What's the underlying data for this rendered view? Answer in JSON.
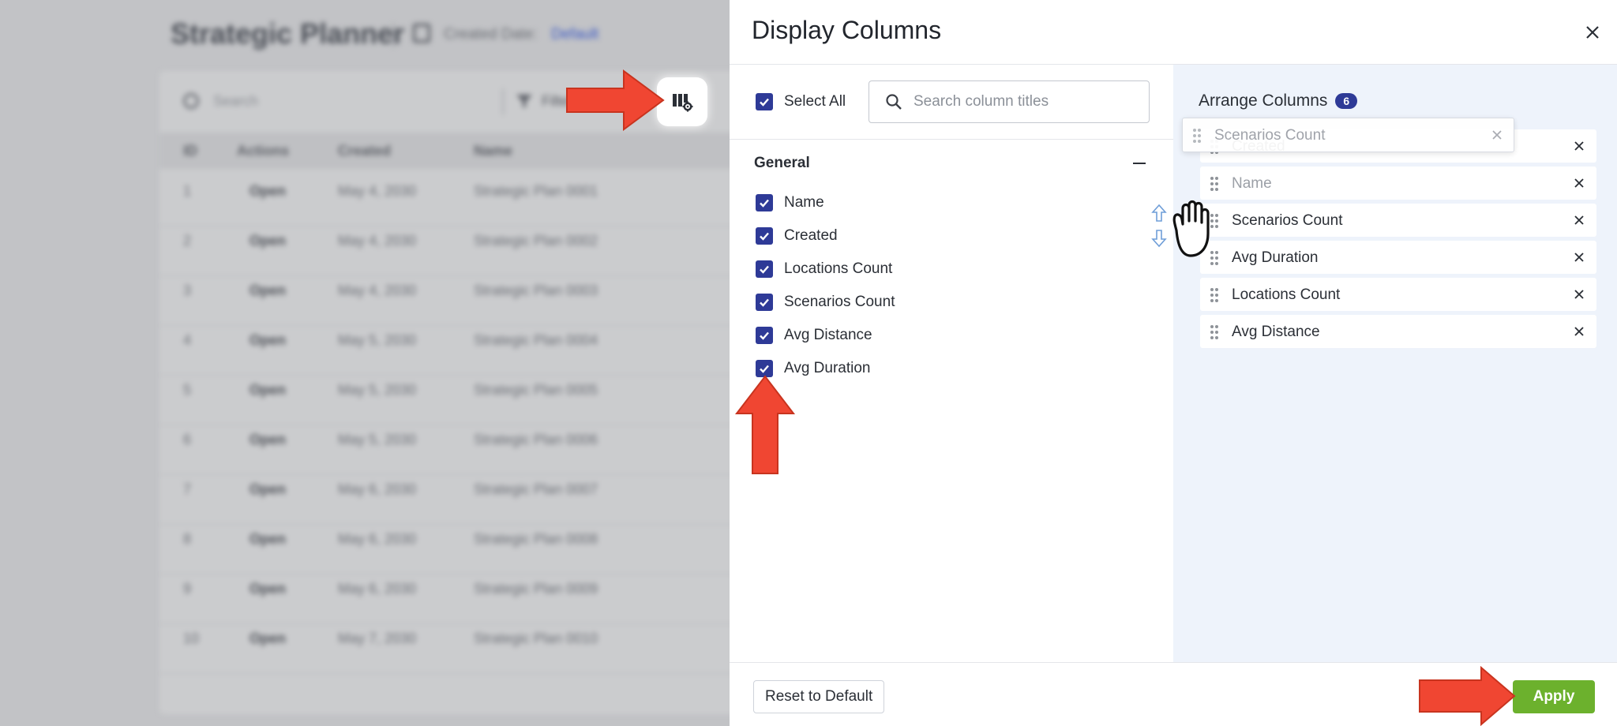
{
  "background": {
    "title": "Strategic Planner",
    "date_label": "Created Date:",
    "date_value": "Default",
    "search_placeholder": "Search",
    "filter_label": "Filter",
    "headers": [
      "ID",
      "Actions",
      "Created",
      "Name"
    ],
    "rows": [
      {
        "id": "1",
        "action": "Open",
        "created": "May 4, 2030",
        "name": "Strategic Plan 0001"
      },
      {
        "id": "2",
        "action": "Open",
        "created": "May 4, 2030",
        "name": "Strategic Plan 0002"
      },
      {
        "id": "3",
        "action": "Open",
        "created": "May 4, 2030",
        "name": "Strategic Plan 0003"
      },
      {
        "id": "4",
        "action": "Open",
        "created": "May 5, 2030",
        "name": "Strategic Plan 0004"
      },
      {
        "id": "5",
        "action": "Open",
        "created": "May 5, 2030",
        "name": "Strategic Plan 0005"
      },
      {
        "id": "6",
        "action": "Open",
        "created": "May 5, 2030",
        "name": "Strategic Plan 0006"
      },
      {
        "id": "7",
        "action": "Open",
        "created": "May 6, 2030",
        "name": "Strategic Plan 0007"
      },
      {
        "id": "8",
        "action": "Open",
        "created": "May 6, 2030",
        "name": "Strategic Plan 0008"
      },
      {
        "id": "9",
        "action": "Open",
        "created": "May 6, 2030",
        "name": "Strategic Plan 0009"
      },
      {
        "id": "10",
        "action": "Open",
        "created": "May 7, 2030",
        "name": "Strategic Plan 0010"
      }
    ]
  },
  "modal": {
    "title": "Display Columns",
    "select_all_label": "Select All",
    "search_placeholder": "Search column titles",
    "group_title": "General",
    "columns": [
      {
        "label": "Name",
        "checked": true
      },
      {
        "label": "Created",
        "checked": true
      },
      {
        "label": "Locations Count",
        "checked": true
      },
      {
        "label": "Scenarios Count",
        "checked": true
      },
      {
        "label": "Avg Distance",
        "checked": true
      },
      {
        "label": "Avg Duration",
        "checked": true
      }
    ],
    "arrange_title": "Arrange Columns",
    "arrange_count": "6",
    "arranged": [
      {
        "label": "Created"
      },
      {
        "label": "Name"
      },
      {
        "label": "Scenarios Count"
      },
      {
        "label": "Avg Duration"
      },
      {
        "label": "Locations Count"
      },
      {
        "label": "Avg Distance"
      }
    ],
    "dragging_label": "Scenarios Count",
    "reset_label": "Reset to Default",
    "apply_label": "Apply"
  },
  "colors": {
    "accent": "#2e3a97",
    "apply": "#6cb12d",
    "annotation_arrow": "#f04632",
    "right_pane_bg": "#eef3fb"
  },
  "icons": [
    "columns-settings-icon",
    "close-icon",
    "search-icon",
    "checkbox-checked-icon",
    "collapse-minus-icon",
    "drag-handle-icon",
    "remove-icon",
    "grab-hand-icon",
    "reorder-arrows-icon",
    "calendar-icon",
    "filter-icon"
  ]
}
